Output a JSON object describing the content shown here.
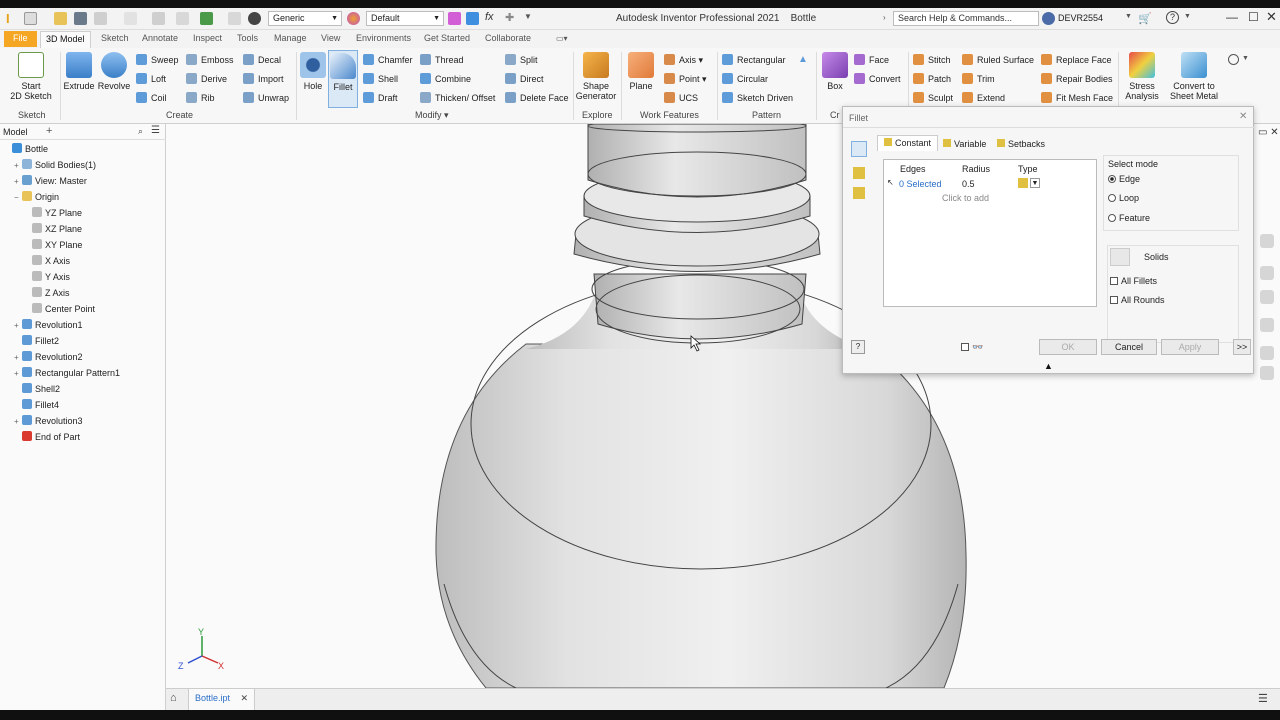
{
  "app": {
    "title": "Autodesk Inventor Professional 2021",
    "document": "Bottle",
    "search_placeholder": "Search Help & Commands...",
    "user": "DEVR2554",
    "appearance": "Generic",
    "material": "Default"
  },
  "tabs": [
    "File",
    "3D Model",
    "Sketch",
    "Annotate",
    "Inspect",
    "Tools",
    "Manage",
    "View",
    "Environments",
    "Get Started",
    "Collaborate"
  ],
  "ribbon": {
    "sketch": {
      "start_sketch": "Start\n2D Sketch",
      "label": "Sketch"
    },
    "create": {
      "extrude": "Extrude",
      "revolve": "Revolve",
      "sweep": "Sweep",
      "loft": "Loft",
      "coil": "Coil",
      "emboss": "Emboss",
      "derive": "Derive",
      "rib": "Rib",
      "decal": "Decal",
      "import": "Import",
      "unwrap": "Unwrap",
      "label": "Create"
    },
    "modify": {
      "hole": "Hole",
      "fillet": "Fillet",
      "chamfer": "Chamfer",
      "shell": "Shell",
      "draft": "Draft",
      "thread": "Thread",
      "combine": "Combine",
      "thicken": "Thicken/ Offset",
      "split": "Split",
      "direct": "Direct",
      "delete_face": "Delete Face",
      "label": "Modify"
    },
    "explore": {
      "shape_generator": "Shape\nGenerator",
      "label": "Explore"
    },
    "work_features": {
      "plane": "Plane",
      "axis": "Axis",
      "point": "Point",
      "ucs": "UCS",
      "label": "Work Features"
    },
    "pattern": {
      "rectangular": "Rectangular",
      "circular": "Circular",
      "sketch_driven": "Sketch Driven",
      "label": "Pattern"
    },
    "freeform": {
      "box": "Box",
      "face": "Face",
      "convert": "Convert",
      "label": "Cr"
    },
    "surface": {
      "stitch": "Stitch",
      "patch": "Patch",
      "sculpt": "Sculpt",
      "ruled_surface": "Ruled Surface",
      "trim": "Trim",
      "extend": "Extend",
      "replace_face": "Replace Face",
      "repair_bodies": "Repair Bodies",
      "fit_mesh_face": "Fit Mesh Face"
    },
    "simulation": {
      "stress_analysis": "Stress\nAnalysis"
    },
    "convert": {
      "sheet_metal": "Convert to\nSheet Metal"
    }
  },
  "browser": {
    "title": "Model",
    "items": [
      {
        "label": "Bottle",
        "indent": 0,
        "exp": "",
        "color": "#3b8fd8"
      },
      {
        "label": "Solid Bodies(1)",
        "indent": 1,
        "exp": "+",
        "color": "#8fb4d9"
      },
      {
        "label": "View: Master",
        "indent": 1,
        "exp": "+",
        "color": "#6aa0cf"
      },
      {
        "label": "Origin",
        "indent": 1,
        "exp": "−",
        "color": "#e8c35a"
      },
      {
        "label": "YZ Plane",
        "indent": 2,
        "exp": "",
        "color": "#bbbbbb"
      },
      {
        "label": "XZ Plane",
        "indent": 2,
        "exp": "",
        "color": "#bbbbbb"
      },
      {
        "label": "XY Plane",
        "indent": 2,
        "exp": "",
        "color": "#bbbbbb"
      },
      {
        "label": "X Axis",
        "indent": 2,
        "exp": "",
        "color": "#bbbbbb"
      },
      {
        "label": "Y Axis",
        "indent": 2,
        "exp": "",
        "color": "#bbbbbb"
      },
      {
        "label": "Z Axis",
        "indent": 2,
        "exp": "",
        "color": "#bbbbbb"
      },
      {
        "label": "Center Point",
        "indent": 2,
        "exp": "",
        "color": "#bbbbbb"
      },
      {
        "label": "Revolution1",
        "indent": 1,
        "exp": "+",
        "color": "#5d9ad6"
      },
      {
        "label": "Fillet2",
        "indent": 1,
        "exp": "",
        "color": "#5d9ad6"
      },
      {
        "label": "Revolution2",
        "indent": 1,
        "exp": "+",
        "color": "#5d9ad6"
      },
      {
        "label": "Rectangular Pattern1",
        "indent": 1,
        "exp": "+",
        "color": "#5d9ad6"
      },
      {
        "label": "Shell2",
        "indent": 1,
        "exp": "",
        "color": "#5d9ad6"
      },
      {
        "label": "Fillet4",
        "indent": 1,
        "exp": "",
        "color": "#5d9ad6"
      },
      {
        "label": "Revolution3",
        "indent": 1,
        "exp": "+",
        "color": "#5d9ad6"
      },
      {
        "label": "End of Part",
        "indent": 1,
        "exp": "",
        "color": "#d9392f"
      }
    ]
  },
  "dialog": {
    "title": "Fillet",
    "tabs": [
      "Constant",
      "Variable",
      "Setbacks"
    ],
    "table": {
      "headers": [
        "Edges",
        "Radius",
        "Type"
      ],
      "row": {
        "edges": "0 Selected",
        "radius": "0.5"
      },
      "add_hint": "Click to add"
    },
    "select_mode": {
      "label": "Select mode",
      "options": [
        "Edge",
        "Loop",
        "Feature"
      ],
      "selected": "Edge"
    },
    "solids_label": "Solids",
    "all_fillets": "All Fillets",
    "all_rounds": "All Rounds",
    "ok": "OK",
    "cancel": "Cancel",
    "apply": "Apply",
    "more": ">>"
  },
  "doc_tab": {
    "label": "Bottle.ipt"
  },
  "triad": {
    "x": "X",
    "y": "Y",
    "z": "Z"
  }
}
